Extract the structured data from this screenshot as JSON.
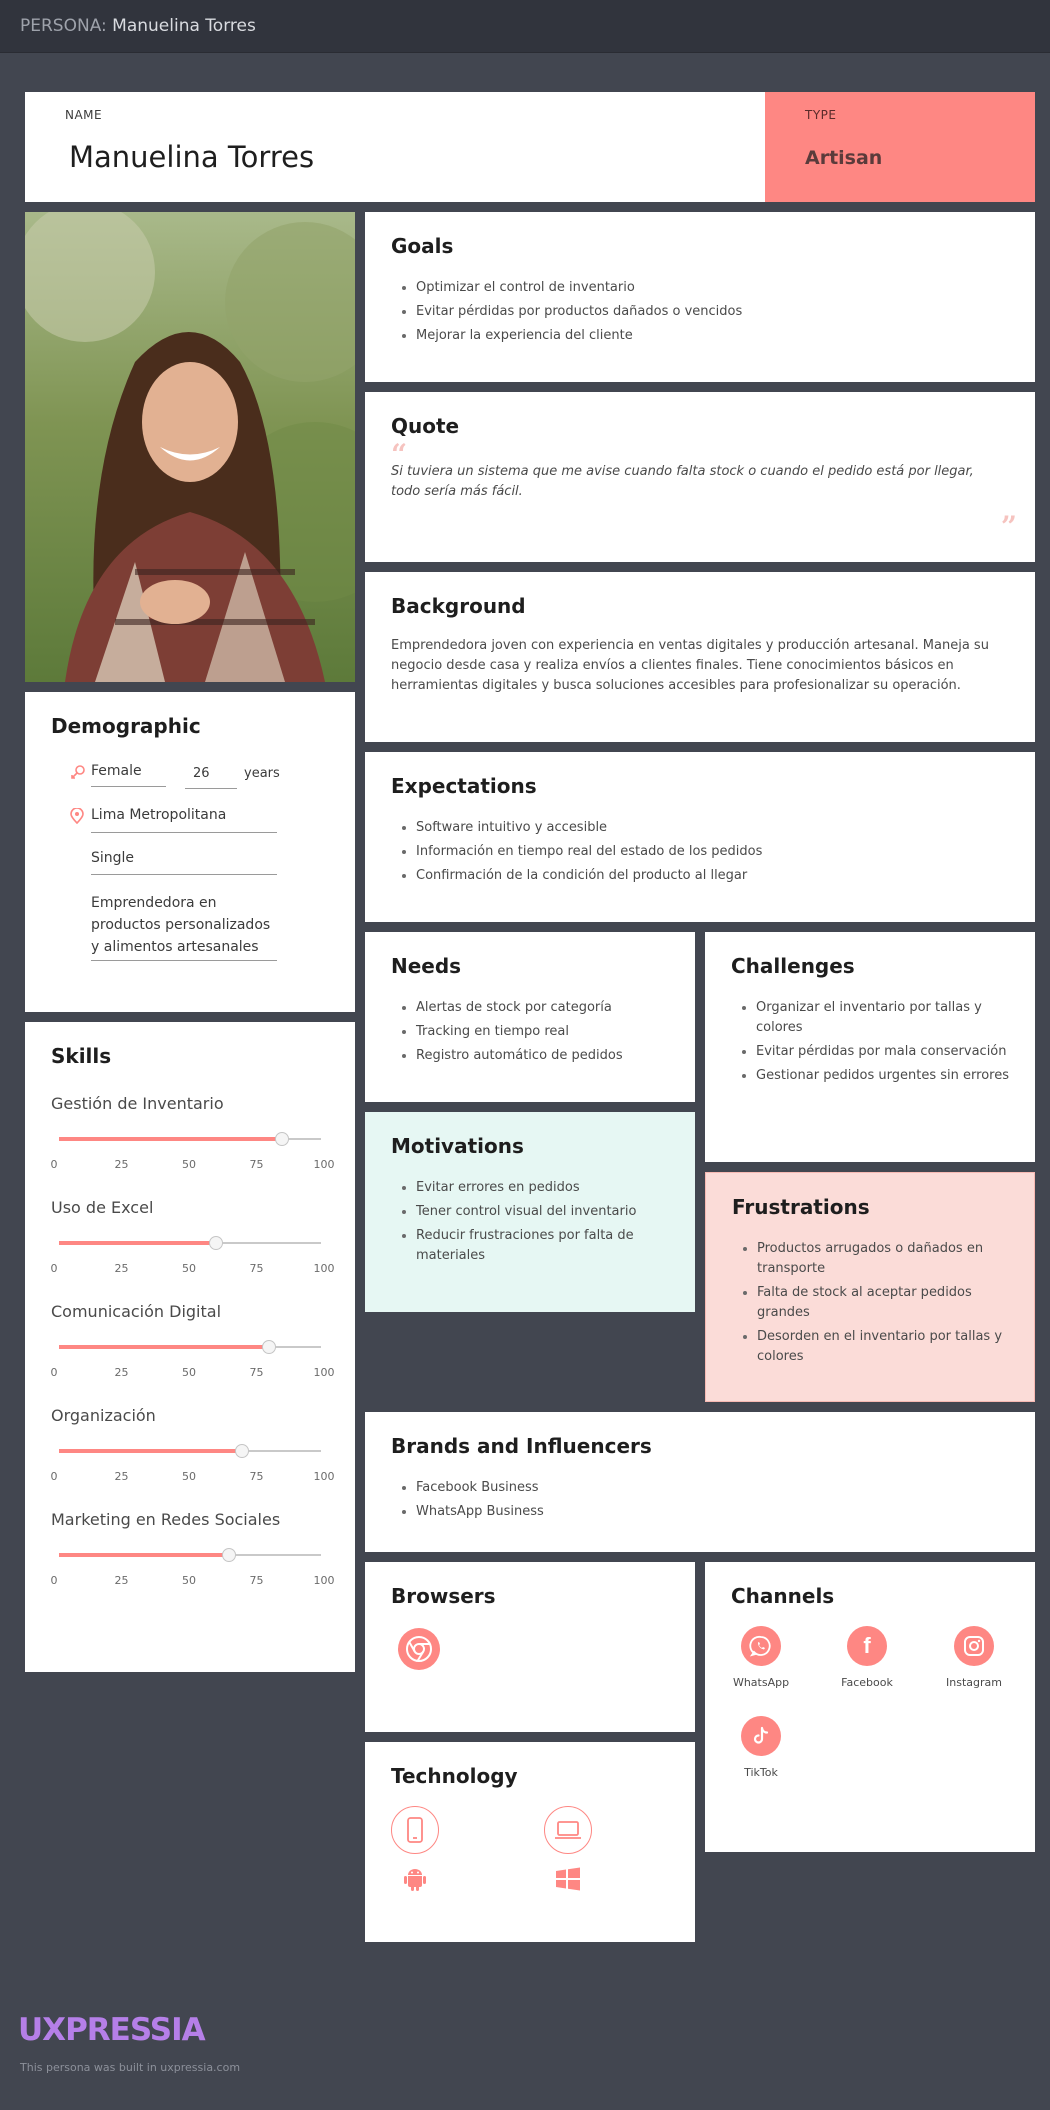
{
  "topbar": {
    "prefix": "PERSONA:",
    "title": "Manuelina Torres"
  },
  "header": {
    "name_label": "NAME",
    "name": "Manuelina Torres",
    "type_label": "TYPE",
    "type": "Artisan"
  },
  "goals": {
    "title": "Goals",
    "items": [
      "Optimizar el control de inventario",
      "Evitar pérdidas por productos dañados o vencidos",
      "Mejorar la experiencia del cliente"
    ]
  },
  "quote": {
    "title": "Quote",
    "open_mark": "“",
    "text": "Si tuviera un sistema que me avise cuando falta stock o cuando el pedido está por llegar, todo sería más fácil.",
    "close_mark": "”"
  },
  "background": {
    "title": "Background",
    "text": "Emprendedora joven con experiencia en ventas digitales y producción artesanal. Maneja su negocio desde casa y realiza envíos a clientes finales. Tiene conocimientos básicos en herramientas digitales y busca soluciones accesibles para profesionalizar su operación."
  },
  "demographic": {
    "title": "Demographic",
    "gender": "Female",
    "age": "26",
    "age_unit": "years",
    "location": "Lima Metropolitana",
    "status": "Single",
    "occupation": "Emprendedora en productos personalizados y alimentos artesanales"
  },
  "expectations": {
    "title": "Expectations",
    "items": [
      "Software intuitivo y accesible",
      "Información en tiempo real del estado de los pedidos",
      "Confirmación de la condición del producto al llegar"
    ]
  },
  "needs": {
    "title": "Needs",
    "items": [
      "Alertas de stock por categoría",
      "Tracking en tiempo real",
      "Registro automático de pedidos"
    ]
  },
  "challenges": {
    "title": "Challenges",
    "items": [
      "Organizar el inventario por tallas y colores",
      "Evitar pérdidas por mala conservación",
      "Gestionar pedidos urgentes sin errores"
    ]
  },
  "motivations": {
    "title": "Motivations",
    "items": [
      "Evitar errores en pedidos",
      "Tener control visual del inventario",
      "Reducir frustraciones por falta de materiales"
    ]
  },
  "frustrations": {
    "title": "Frustrations",
    "items": [
      "Productos arrugados o dañados en transporte",
      "Falta de stock al aceptar pedidos grandes",
      "Desorden en el inventario por tallas y colores"
    ]
  },
  "skills": {
    "title": "Skills",
    "ticks": [
      "0",
      "25",
      "50",
      "75",
      "100"
    ],
    "items": [
      {
        "name": "Gestión de Inventario",
        "value": 85
      },
      {
        "name": "Uso de Excel",
        "value": 60
      },
      {
        "name": "Comunicación Digital",
        "value": 80
      },
      {
        "name": "Organización",
        "value": 70
      },
      {
        "name": "Marketing en Redes Sociales",
        "value": 65
      }
    ]
  },
  "brands": {
    "title": "Brands and Influencers",
    "items": [
      "Facebook Business",
      "WhatsApp Business"
    ]
  },
  "browsers": {
    "title": "Browsers",
    "items": [
      "chrome-icon"
    ]
  },
  "channels": {
    "title": "Channels",
    "items": [
      {
        "label": "WhatsApp",
        "icon": "whatsapp-icon"
      },
      {
        "label": "Facebook",
        "icon": "facebook-icon"
      },
      {
        "label": "Instagram",
        "icon": "instagram-icon"
      },
      {
        "label": "TikTok",
        "icon": "tiktok-icon"
      }
    ]
  },
  "technology": {
    "title": "Technology",
    "items": [
      "mobile-icon",
      "laptop-icon",
      "android-icon",
      "windows-icon"
    ]
  },
  "footer": {
    "logo": "UXPRESSIA",
    "note": "This persona was built in uxpressia.com"
  },
  "colors": {
    "accent": "#fe8783",
    "background": "#424650",
    "motivations": "#e6f7f3",
    "frustrations": "#fbdcd8"
  }
}
